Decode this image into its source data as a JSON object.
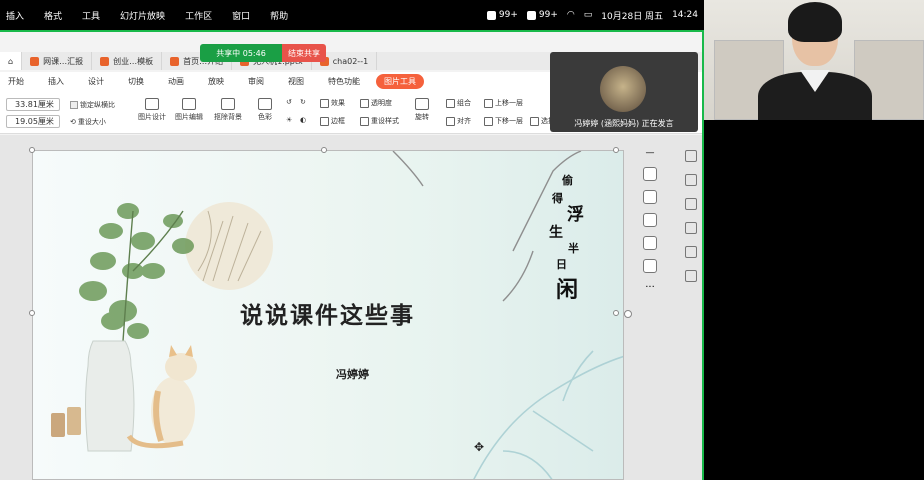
{
  "menubar": {
    "items": [
      "插入",
      "格式",
      "工具",
      "幻灯片放映",
      "工作区",
      "窗口",
      "帮助"
    ],
    "status": [
      "99+",
      "99+"
    ],
    "date": "10月28日 周五",
    "time": "14:24"
  },
  "share": {
    "sharing_label": "共享中 05:46",
    "end_label": "结束共享"
  },
  "tabs": [
    {
      "label": "网课…汇报"
    },
    {
      "label": "创业…模板"
    },
    {
      "label": "首页…介绍"
    },
    {
      "label": "无人机1.pptx"
    },
    {
      "label": "cha02--1"
    }
  ],
  "ribbon_tabs": [
    "开始",
    "插入",
    "设计",
    "切换",
    "动画",
    "放映",
    "审阅",
    "视图",
    "特色功能",
    "图片工具"
  ],
  "ribbon": {
    "width_value": "33.81厘米",
    "height_value": "19.05厘米",
    "lock_ratio": "锁定纵横比",
    "reset_size": "重设大小",
    "tools": [
      "图片设计",
      "图片编辑",
      "抠除背景",
      "色彩"
    ],
    "effects": "效果",
    "transparency": "透明度",
    "border": "边框",
    "reset_style": "重设样式",
    "rotate": "旋转",
    "group": "组合",
    "align": "对齐",
    "move_up": "上移一层",
    "move_down": "下移一层",
    "select": "选择"
  },
  "slide": {
    "title": "说说课件这些事",
    "author": "冯婷婷",
    "poem": [
      "偷",
      "得",
      "浮",
      "生",
      "半",
      "日",
      "闲"
    ]
  },
  "speaker": {
    "label": "冯婷婷 (涵熙妈妈) 正在发言"
  },
  "colors": {
    "share_green": "#1a9f45",
    "end_red": "#e8534a",
    "accent": "#f5613c"
  }
}
